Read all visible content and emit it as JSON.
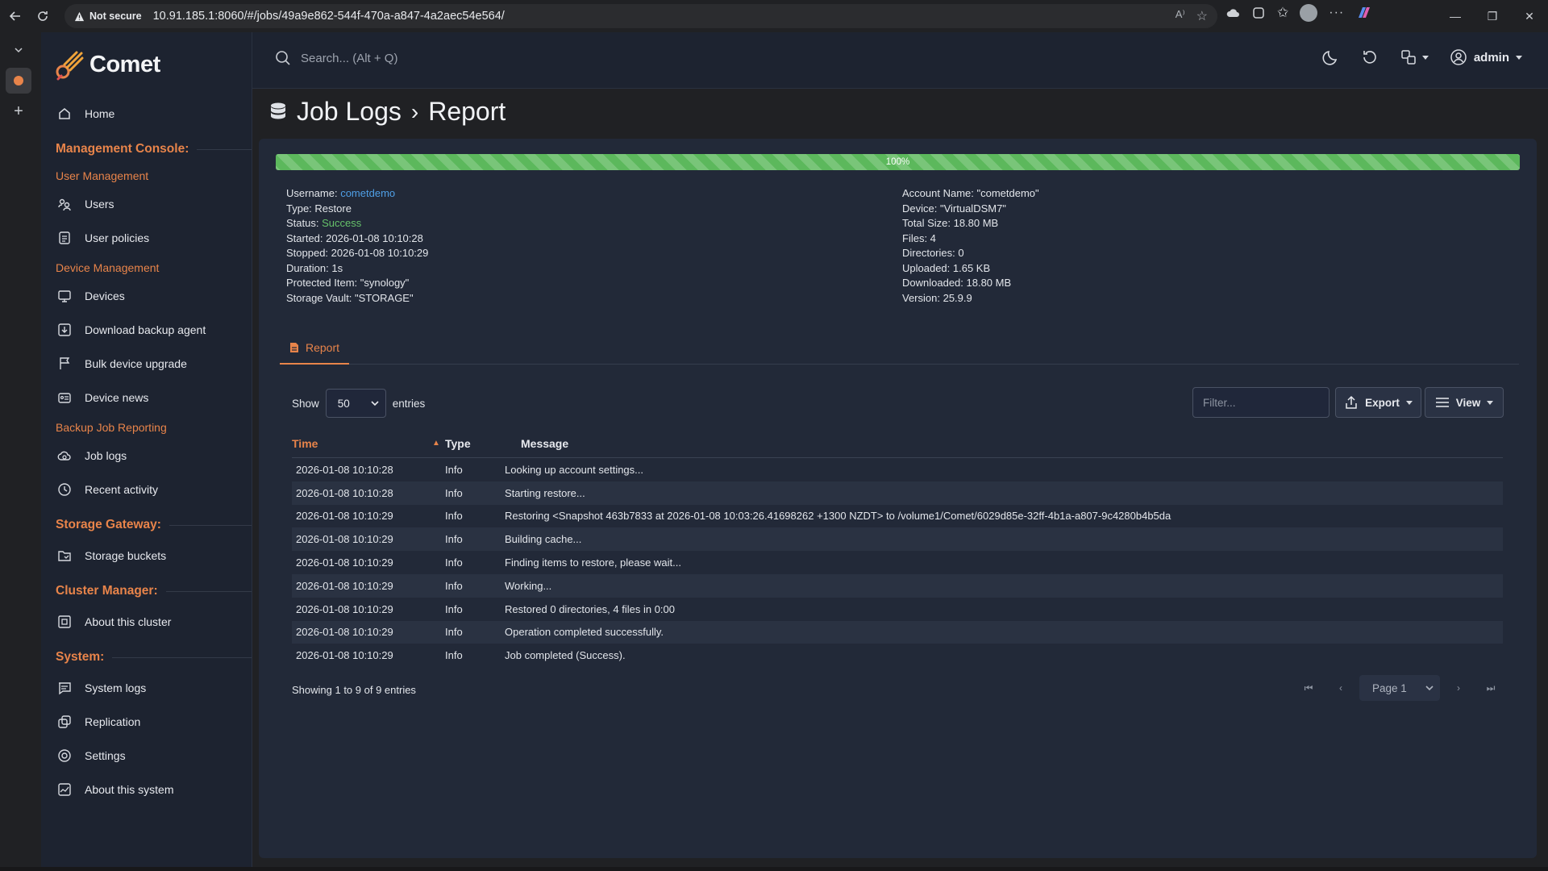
{
  "browser": {
    "security_label": "Not secure",
    "url": "10.91.185.1:8060/#/jobs/49a9e862-544f-470a-a847-4a2aec54e564/"
  },
  "app": {
    "name": "Comet"
  },
  "search": {
    "placeholder": "Search... (Alt + Q)"
  },
  "user": {
    "name": "admin"
  },
  "sidebar": {
    "home": "Home",
    "sections": {
      "management": "Management Console:",
      "user_mgmt": "User Management",
      "device_mgmt": "Device Management",
      "backup_reporting": "Backup Job Reporting",
      "storage_gateway": "Storage Gateway:",
      "cluster_manager": "Cluster Manager:",
      "system": "System:"
    },
    "items": {
      "users": "Users",
      "user_policies": "User policies",
      "devices": "Devices",
      "download_agent": "Download backup agent",
      "bulk_upgrade": "Bulk device upgrade",
      "device_news": "Device news",
      "job_logs": "Job logs",
      "recent_activity": "Recent activity",
      "storage_buckets": "Storage buckets",
      "about_cluster": "About this cluster",
      "system_logs": "System logs",
      "replication": "Replication",
      "settings": "Settings",
      "about_system": "About this system"
    }
  },
  "page": {
    "breadcrumb_parent": "Job Logs",
    "breadcrumb_sep": "›",
    "breadcrumb_current": "Report"
  },
  "progress": {
    "value": 100,
    "label": "100%"
  },
  "job": {
    "left": {
      "username_label": "Username:",
      "username": "cometdemo",
      "type": "Type: Restore",
      "status_label": "Status:",
      "status": "Success",
      "started": "Started: 2026-01-08 10:10:28",
      "stopped": "Stopped: 2026-01-08 10:10:29",
      "duration": "Duration: 1s",
      "protected_item": "Protected Item: \"synology\"",
      "storage_vault": "Storage Vault: \"STORAGE\""
    },
    "right": {
      "account_name": "Account Name: \"cometdemo\"",
      "device": "Device: \"VirtualDSM7\"",
      "total_size": "Total Size: 18.80 MB",
      "files": "Files: 4",
      "directories": "Directories: 0",
      "uploaded": "Uploaded: 1.65 KB",
      "downloaded": "Downloaded: 18.80 MB",
      "version": "Version: 25.9.9"
    }
  },
  "tabs": {
    "report": "Report"
  },
  "controls": {
    "show": "Show",
    "entries_value": "50",
    "entries": "entries",
    "filter_placeholder": "Filter...",
    "export": "Export",
    "view": "View"
  },
  "table": {
    "headers": {
      "time": "Time",
      "type": "Type",
      "message": "Message"
    },
    "rows": [
      {
        "time": "2026-01-08 10:10:28",
        "type": "Info",
        "message": "Looking up account settings..."
      },
      {
        "time": "2026-01-08 10:10:28",
        "type": "Info",
        "message": "Starting restore..."
      },
      {
        "time": "2026-01-08 10:10:29",
        "type": "Info",
        "message": "Restoring <Snapshot 463b7833 at 2026-01-08 10:03:26.41698262 +1300 NZDT> to /volume1/Comet/6029d85e-32ff-4b1a-a807-9c4280b4b5da"
      },
      {
        "time": "2026-01-08 10:10:29",
        "type": "Info",
        "message": "Building cache..."
      },
      {
        "time": "2026-01-08 10:10:29",
        "type": "Info",
        "message": "Finding items to restore, please wait..."
      },
      {
        "time": "2026-01-08 10:10:29",
        "type": "Info",
        "message": "Working..."
      },
      {
        "time": "2026-01-08 10:10:29",
        "type": "Info",
        "message": "Restored 0 directories, 4 files in 0:00"
      },
      {
        "time": "2026-01-08 10:10:29",
        "type": "Info",
        "message": "Operation completed successfully."
      },
      {
        "time": "2026-01-08 10:10:29",
        "type": "Info",
        "message": "Job completed (Success)."
      }
    ],
    "footer": "Showing 1 to 9 of 9 entries",
    "page_label": "Page 1"
  },
  "colors": {
    "accent": "#e8844a",
    "success": "#66c26a",
    "link": "#4f9fe6",
    "progress": "#5cb85c"
  }
}
